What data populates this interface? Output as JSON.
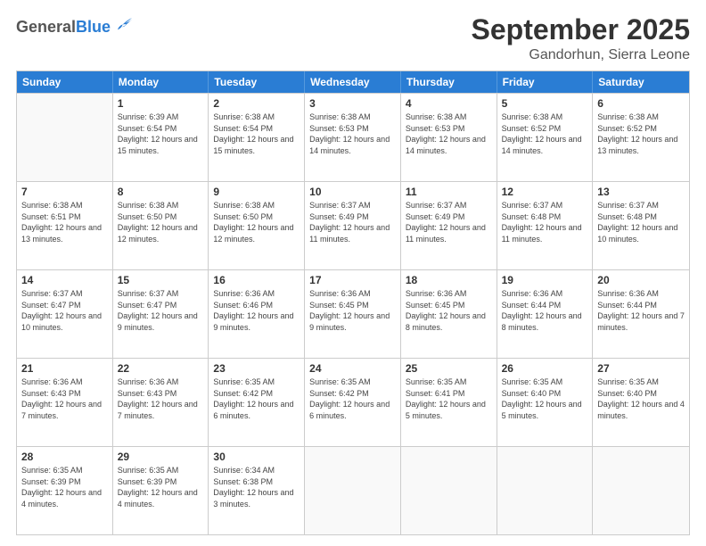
{
  "header": {
    "logo_general": "General",
    "logo_blue": "Blue",
    "month_title": "September 2025",
    "subtitle": "Gandorhun, Sierra Leone"
  },
  "calendar": {
    "days_of_week": [
      "Sunday",
      "Monday",
      "Tuesday",
      "Wednesday",
      "Thursday",
      "Friday",
      "Saturday"
    ],
    "weeks": [
      [
        {
          "day": null,
          "sunrise": null,
          "sunset": null,
          "daylight": null
        },
        {
          "day": "1",
          "sunrise": "Sunrise: 6:39 AM",
          "sunset": "Sunset: 6:54 PM",
          "daylight": "Daylight: 12 hours and 15 minutes."
        },
        {
          "day": "2",
          "sunrise": "Sunrise: 6:38 AM",
          "sunset": "Sunset: 6:54 PM",
          "daylight": "Daylight: 12 hours and 15 minutes."
        },
        {
          "day": "3",
          "sunrise": "Sunrise: 6:38 AM",
          "sunset": "Sunset: 6:53 PM",
          "daylight": "Daylight: 12 hours and 14 minutes."
        },
        {
          "day": "4",
          "sunrise": "Sunrise: 6:38 AM",
          "sunset": "Sunset: 6:53 PM",
          "daylight": "Daylight: 12 hours and 14 minutes."
        },
        {
          "day": "5",
          "sunrise": "Sunrise: 6:38 AM",
          "sunset": "Sunset: 6:52 PM",
          "daylight": "Daylight: 12 hours and 14 minutes."
        },
        {
          "day": "6",
          "sunrise": "Sunrise: 6:38 AM",
          "sunset": "Sunset: 6:52 PM",
          "daylight": "Daylight: 12 hours and 13 minutes."
        }
      ],
      [
        {
          "day": "7",
          "sunrise": "Sunrise: 6:38 AM",
          "sunset": "Sunset: 6:51 PM",
          "daylight": "Daylight: 12 hours and 13 minutes."
        },
        {
          "day": "8",
          "sunrise": "Sunrise: 6:38 AM",
          "sunset": "Sunset: 6:50 PM",
          "daylight": "Daylight: 12 hours and 12 minutes."
        },
        {
          "day": "9",
          "sunrise": "Sunrise: 6:38 AM",
          "sunset": "Sunset: 6:50 PM",
          "daylight": "Daylight: 12 hours and 12 minutes."
        },
        {
          "day": "10",
          "sunrise": "Sunrise: 6:37 AM",
          "sunset": "Sunset: 6:49 PM",
          "daylight": "Daylight: 12 hours and 11 minutes."
        },
        {
          "day": "11",
          "sunrise": "Sunrise: 6:37 AM",
          "sunset": "Sunset: 6:49 PM",
          "daylight": "Daylight: 12 hours and 11 minutes."
        },
        {
          "day": "12",
          "sunrise": "Sunrise: 6:37 AM",
          "sunset": "Sunset: 6:48 PM",
          "daylight": "Daylight: 12 hours and 11 minutes."
        },
        {
          "day": "13",
          "sunrise": "Sunrise: 6:37 AM",
          "sunset": "Sunset: 6:48 PM",
          "daylight": "Daylight: 12 hours and 10 minutes."
        }
      ],
      [
        {
          "day": "14",
          "sunrise": "Sunrise: 6:37 AM",
          "sunset": "Sunset: 6:47 PM",
          "daylight": "Daylight: 12 hours and 10 minutes."
        },
        {
          "day": "15",
          "sunrise": "Sunrise: 6:37 AM",
          "sunset": "Sunset: 6:47 PM",
          "daylight": "Daylight: 12 hours and 9 minutes."
        },
        {
          "day": "16",
          "sunrise": "Sunrise: 6:36 AM",
          "sunset": "Sunset: 6:46 PM",
          "daylight": "Daylight: 12 hours and 9 minutes."
        },
        {
          "day": "17",
          "sunrise": "Sunrise: 6:36 AM",
          "sunset": "Sunset: 6:45 PM",
          "daylight": "Daylight: 12 hours and 9 minutes."
        },
        {
          "day": "18",
          "sunrise": "Sunrise: 6:36 AM",
          "sunset": "Sunset: 6:45 PM",
          "daylight": "Daylight: 12 hours and 8 minutes."
        },
        {
          "day": "19",
          "sunrise": "Sunrise: 6:36 AM",
          "sunset": "Sunset: 6:44 PM",
          "daylight": "Daylight: 12 hours and 8 minutes."
        },
        {
          "day": "20",
          "sunrise": "Sunrise: 6:36 AM",
          "sunset": "Sunset: 6:44 PM",
          "daylight": "Daylight: 12 hours and 7 minutes."
        }
      ],
      [
        {
          "day": "21",
          "sunrise": "Sunrise: 6:36 AM",
          "sunset": "Sunset: 6:43 PM",
          "daylight": "Daylight: 12 hours and 7 minutes."
        },
        {
          "day": "22",
          "sunrise": "Sunrise: 6:36 AM",
          "sunset": "Sunset: 6:43 PM",
          "daylight": "Daylight: 12 hours and 7 minutes."
        },
        {
          "day": "23",
          "sunrise": "Sunrise: 6:35 AM",
          "sunset": "Sunset: 6:42 PM",
          "daylight": "Daylight: 12 hours and 6 minutes."
        },
        {
          "day": "24",
          "sunrise": "Sunrise: 6:35 AM",
          "sunset": "Sunset: 6:42 PM",
          "daylight": "Daylight: 12 hours and 6 minutes."
        },
        {
          "day": "25",
          "sunrise": "Sunrise: 6:35 AM",
          "sunset": "Sunset: 6:41 PM",
          "daylight": "Daylight: 12 hours and 5 minutes."
        },
        {
          "day": "26",
          "sunrise": "Sunrise: 6:35 AM",
          "sunset": "Sunset: 6:40 PM",
          "daylight": "Daylight: 12 hours and 5 minutes."
        },
        {
          "day": "27",
          "sunrise": "Sunrise: 6:35 AM",
          "sunset": "Sunset: 6:40 PM",
          "daylight": "Daylight: 12 hours and 4 minutes."
        }
      ],
      [
        {
          "day": "28",
          "sunrise": "Sunrise: 6:35 AM",
          "sunset": "Sunset: 6:39 PM",
          "daylight": "Daylight: 12 hours and 4 minutes."
        },
        {
          "day": "29",
          "sunrise": "Sunrise: 6:35 AM",
          "sunset": "Sunset: 6:39 PM",
          "daylight": "Daylight: 12 hours and 4 minutes."
        },
        {
          "day": "30",
          "sunrise": "Sunrise: 6:34 AM",
          "sunset": "Sunset: 6:38 PM",
          "daylight": "Daylight: 12 hours and 3 minutes."
        },
        {
          "day": null,
          "sunrise": null,
          "sunset": null,
          "daylight": null
        },
        {
          "day": null,
          "sunrise": null,
          "sunset": null,
          "daylight": null
        },
        {
          "day": null,
          "sunrise": null,
          "sunset": null,
          "daylight": null
        },
        {
          "day": null,
          "sunrise": null,
          "sunset": null,
          "daylight": null
        }
      ]
    ]
  }
}
